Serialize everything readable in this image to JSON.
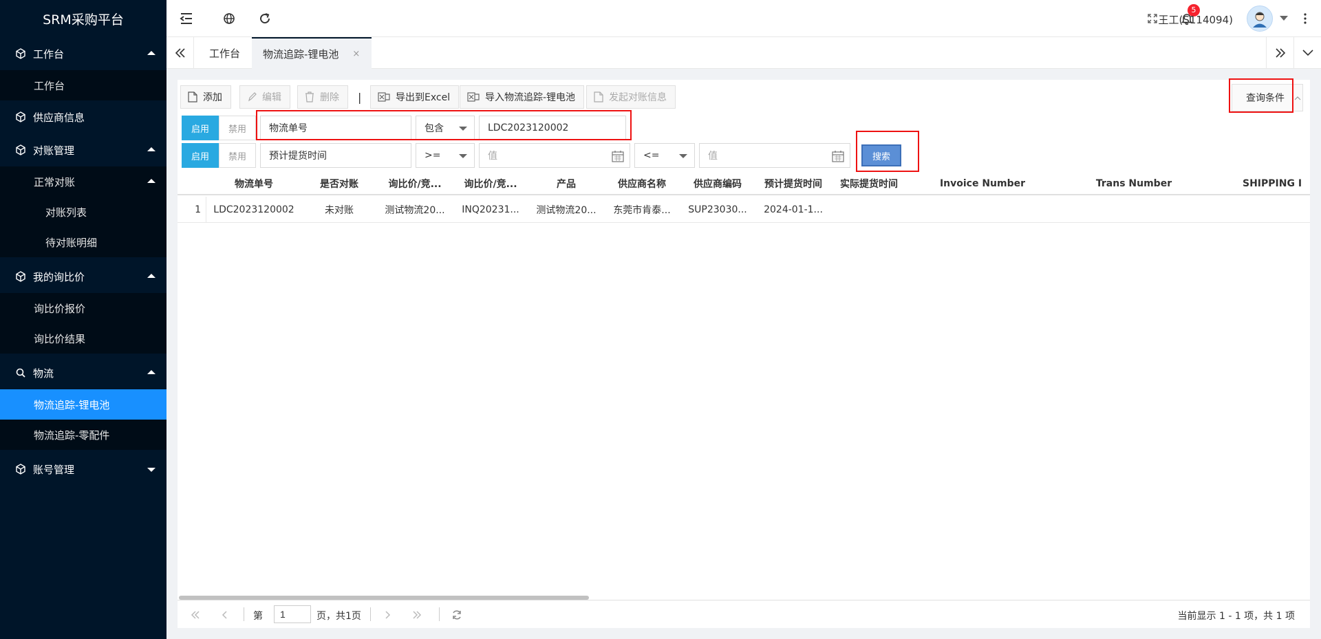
{
  "app": {
    "title": "SRM采购平台"
  },
  "sidebar": {
    "groups": [
      {
        "label": "工作台",
        "items": [
          {
            "label": "工作台"
          }
        ]
      },
      {
        "label": "供应商信息"
      },
      {
        "label": "对账管理",
        "sub": {
          "label": "正常对账",
          "items": [
            {
              "label": "对账列表"
            },
            {
              "label": "待对账明细"
            }
          ]
        }
      },
      {
        "label": "我的询比价",
        "items": [
          {
            "label": "询比价报价"
          },
          {
            "label": "询比价结果"
          }
        ]
      },
      {
        "label": "物流",
        "items": [
          {
            "label": "物流追踪-锂电池"
          },
          {
            "label": "物流追踪-零配件"
          }
        ]
      },
      {
        "label": "账号管理"
      }
    ]
  },
  "header": {
    "notification_count": "5",
    "user_name": "王工(S114094)"
  },
  "tabs": [
    {
      "label": "工作台"
    },
    {
      "label": "物流追踪-锂电池",
      "close": "×"
    }
  ],
  "toolbar": {
    "add": "添加",
    "edit": "编辑",
    "delete": "删除",
    "separator": "|",
    "export_excel": "导出到Excel",
    "import": "导入物流追踪-锂电池",
    "send_reconcile": "发起对账信息",
    "query_conditions": "查询条件"
  },
  "filters": [
    {
      "enable": "启用",
      "disable": "禁用",
      "field": "物流单号",
      "operator": "包含",
      "value": "LDC2023120002"
    },
    {
      "enable": "启用",
      "disable": "禁用",
      "field": "预计提货时间",
      "operator1": ">=",
      "value1_placeholder": "值",
      "operator2": "<=",
      "value2_placeholder": "值"
    }
  ],
  "search_button": "搜索",
  "table": {
    "columns": [
      "物流单号",
      "是否对账",
      "询比价/竞...",
      "询比价/竞...",
      "产品",
      "供应商名称",
      "供应商编码",
      "预计提货时间",
      "实际提货时间",
      "Invoice Number",
      "Trans Number",
      "SHIPPING I"
    ],
    "rows": [
      {
        "index": "1",
        "cells": [
          "LDC2023120002",
          "未对账",
          "测试物流20...",
          "INQ20231...",
          "测试物流20...",
          "东莞市肯泰...",
          "SUP23030...",
          "2024-01-1...",
          "",
          "",
          "",
          ""
        ]
      }
    ]
  },
  "pager": {
    "page_prefix": "第",
    "page_value": "1",
    "page_suffix": "页，共1页",
    "summary": "当前显示 1 - 1 项，共 1 项"
  },
  "colors": {
    "sidebar_bg": "#001529",
    "active_item": "#1890ff",
    "toggle_on": "#29a9e1",
    "highlight": "#ee1111"
  }
}
